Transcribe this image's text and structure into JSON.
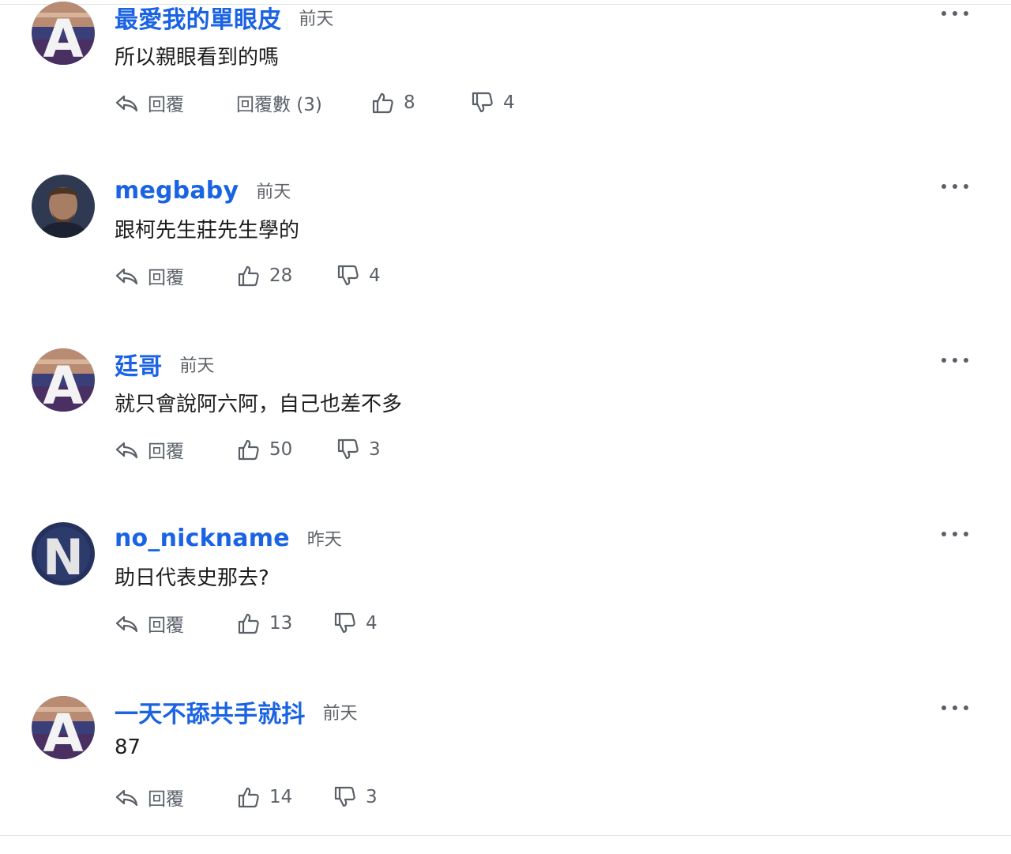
{
  "comments": [
    {
      "avatar_letter": "A",
      "name": "最愛我的單眼皮",
      "time": "前天",
      "text": "所以親眼看到的嗎",
      "reply_label": "回覆",
      "replies_label": "回覆數 (3)",
      "likes": "8",
      "dislikes": "4"
    },
    {
      "avatar_letter": "",
      "name": "megbaby",
      "time": "前天",
      "text": "跟柯先生莊先生學的",
      "reply_label": "回覆",
      "likes": "28",
      "dislikes": "4"
    },
    {
      "avatar_letter": "A",
      "name": "廷哥",
      "time": "前天",
      "text": "就只會說阿六阿，自己也差不多",
      "reply_label": "回覆",
      "likes": "50",
      "dislikes": "3"
    },
    {
      "avatar_letter": "N",
      "name": "no_nickname",
      "time": "昨天",
      "text": "助日代表史那去?",
      "reply_label": "回覆",
      "likes": "13",
      "dislikes": "4"
    },
    {
      "avatar_letter": "A",
      "name": "一天不舔共手就抖",
      "time": "前天",
      "text": "87",
      "reply_label": "回覆",
      "likes": "14",
      "dislikes": "3"
    }
  ],
  "colors": {
    "name_blue": "#1a63e3",
    "icon_gray": "#5b6068"
  }
}
